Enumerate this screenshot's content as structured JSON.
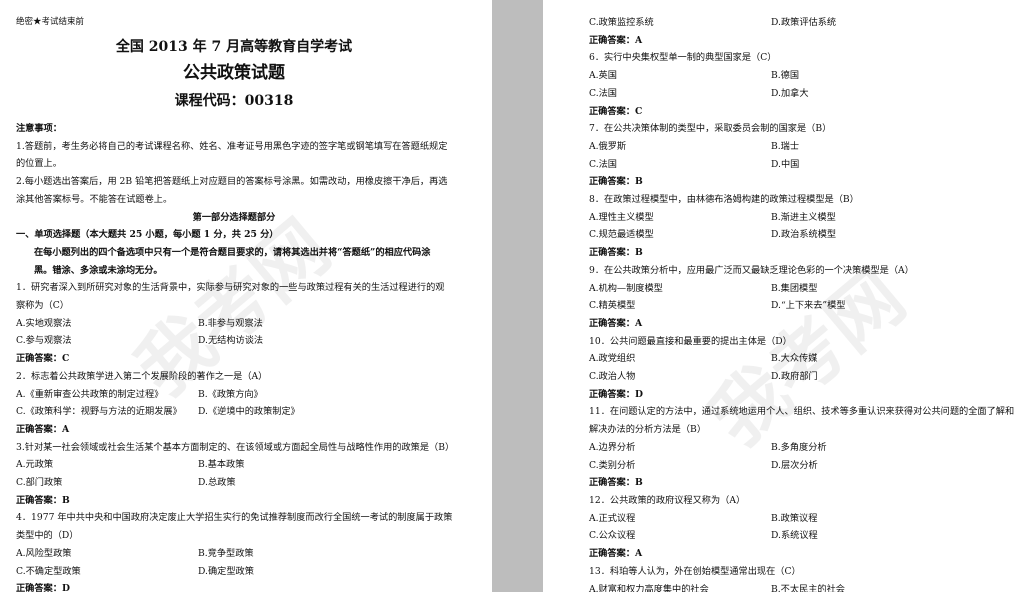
{
  "left": {
    "secret": "绝密★考试结束前",
    "title1": "全国 2013 年 7 月高等教育自学考试",
    "title2": "公共政策试题",
    "title3": "课程代码：00318",
    "notice_head": "注意事项：",
    "notice1a": "1.答题前，考生务必将自己的考试课程名称、姓名、准考证号用黑色字迹的签字笔或钢笔填写在答题纸规定",
    "notice1b": "的位置上。",
    "notice2a": "2.每小题选出答案后，用 2B 铅笔把答题纸上对应题目的答案标号涂黑。如需改动，用橡皮擦干净后，再选",
    "notice2b": "涂其他答案标号。不能答在试题卷上。",
    "part_head": "第一部分选择题部分",
    "section": "一、单项选择题（本大题共 25 小题，每小题 1 分，共 25 分）",
    "instr1": "在每小题列出的四个备选项中只有一个是符合题目要求的，请将其选出并将“答题纸”的相应代码涂",
    "instr2": "黑。错涂、多涂或未涂均无分。",
    "q1a": "1．研究者深入到所研究对象的生活背景中，实际参与研究对象的一些与政策过程有关的生活过程进行的观",
    "q1b": "察称为（C）",
    "q1": {
      "A": "A.实地观察法",
      "B": "B.非参与观察法",
      "C": "C.参与观察法",
      "D": "D.无结构访谈法"
    },
    "q2": "2．标志着公共政策学进入第二个发展阶段的著作之一是（A）",
    "q2o": {
      "A": "A.《重新审查公共政策的制定过程》",
      "B": "B.《政策方向》",
      "C": "C.《政策科学：视野与方法的近期发展》",
      "D": "D.《逆境中的政策制定》"
    },
    "q3": "3.针对某一社会领域或社会生活某个基本方面制定的、在该领域或方面起全局性与战略性作用的政策是（B）",
    "q3o": {
      "A": "A.元政策",
      "B": "B.基本政策",
      "C": "C.部门政策",
      "D": "D.总政策"
    },
    "q4a": "4．1977 年中共中央和中国政府决定废止大学招生实行的免试推荐制度而改行全国统一考试的制度属于政策",
    "q4b": "类型中的（D）",
    "q4o": {
      "A": "A.风险型政策",
      "B": "B.竞争型政策",
      "C": "C.不确定型政策",
      "D": "D.确定型政策"
    },
    "ans_label": "正确答案：",
    "ans": {
      "q1": "C",
      "q2": "A",
      "q3": "B",
      "q4": "D"
    }
  },
  "right": {
    "q5o": {
      "C": "C.政策监控系统",
      "D": "D.政策评估系统"
    },
    "q6": "6．实行中央集权型单一制的典型国家是（C）",
    "q6o": {
      "A": "A.英国",
      "B": "B.德国",
      "C": "C.法国",
      "D": "D.加拿大"
    },
    "q7": "7．在公共决策体制的类型中，采取委员会制的国家是（B）",
    "q7o": {
      "A": "A.俄罗斯",
      "B": "B.瑞士",
      "C": "C.法国",
      "D": "D.中国"
    },
    "q8": "8．在政策过程模型中，由林德布洛姆构建的政策过程模型是（B）",
    "q8o": {
      "A": "A.理性主义模型",
      "B": "B.渐进主义模型",
      "C": "C.规范最适模型",
      "D": "D.政治系统模型"
    },
    "q9": "9．在公共政策分析中，应用最广泛而又最缺乏理论色彩的一个决策模型是（A）",
    "q9o": {
      "A": "A.机构—制度模型",
      "B": "B.集团模型",
      "C": "C.精英模型",
      "D": "D.“上下来去”模型"
    },
    "q10": "10．公共问题最直接和最重要的提出主体是（D）",
    "q10o": {
      "A": "A.政党组织",
      "B": "B.大众传媒",
      "C": "C.政治人物",
      "D": "D.政府部门"
    },
    "q11a": "11．在问题认定的方法中，通过系统地运用个人、组织、技术等多重认识来获得对公共问题的全面了解和",
    "q11b": "解决办法的分析方法是（B）",
    "q11o": {
      "A": "A.边界分析",
      "B": "B.多角度分析",
      "C": "C.类别分析",
      "D": "D.层次分析"
    },
    "q12": "12．公共政策的政府议程又称为（A）",
    "q12o": {
      "A": "A.正式议程",
      "B": "B.政策议程",
      "C": "C.公众议程",
      "D": "D.系统议程"
    },
    "q13": "13．科珀等人认为，外在创始模型通常出现在（C）",
    "q13o": {
      "A": "A.财富和权力高度集中的社会",
      "B": "B.不太民主的社会"
    },
    "ans_label": "正确答案：",
    "ans": {
      "q5": "A",
      "q6": "C",
      "q7": "B",
      "q8": "B",
      "q9": "A",
      "q10": "D",
      "q11": "B",
      "q12": "A"
    }
  }
}
